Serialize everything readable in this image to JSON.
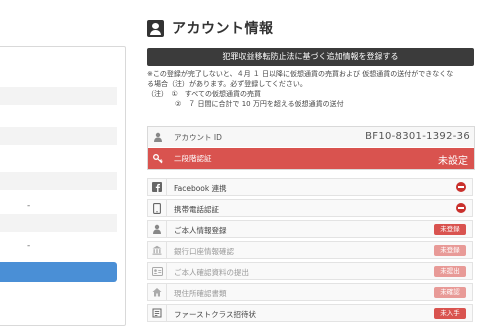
{
  "header": {
    "title": "アカウント情報",
    "icon": "user-card-icon"
  },
  "register_button": {
    "label": "犯罪収益移転防止法に基づく追加情報を登録する"
  },
  "notice": {
    "line1": "※この登録が完了しないと、４月 １ 日以降に仮想通貨の売買および 仮想通貨の送付ができなくな",
    "line2": "る場合（注）があります。必ず登録してください。",
    "line3": "（注）　①　すべての仮想通貨の売買",
    "line4": "　　　　②　７ 日間に合計で 10 万円を超える仮想通貨の送付"
  },
  "account": {
    "id_label": "アカウント ID",
    "id_value": "BF10-8301-1392-36",
    "tfa_label": "二段階認証",
    "tfa_status": "未設定"
  },
  "verification_items": [
    {
      "label": "Facebook 連携",
      "icon": "facebook-icon",
      "status_type": "minus"
    },
    {
      "label": "携帯電話認証",
      "icon": "phone-icon",
      "status_type": "minus"
    },
    {
      "label": "ご本人情報登録",
      "icon": "person-icon",
      "status": "未登録",
      "status_type": "badge"
    },
    {
      "label": "銀行口座情報確認",
      "icon": "bank-icon",
      "status": "未登録",
      "status_type": "badge-light"
    },
    {
      "label": "ご本人確認資料の提出",
      "icon": "id-card-icon",
      "status": "未提出",
      "status_type": "badge-light"
    },
    {
      "label": "現住所確認書類",
      "icon": "home-icon",
      "status": "未確認",
      "status_type": "badge-light"
    },
    {
      "label": "ファーストクラス招待状",
      "icon": "ticket-icon",
      "status": "未入手",
      "status_type": "badge"
    }
  ],
  "colors": {
    "danger": "#d9534f",
    "dark_button": "#3b3b3b",
    "primary": "#4a8fd6"
  },
  "left_panel": {
    "dashes": [
      "-",
      "-",
      "-"
    ]
  }
}
